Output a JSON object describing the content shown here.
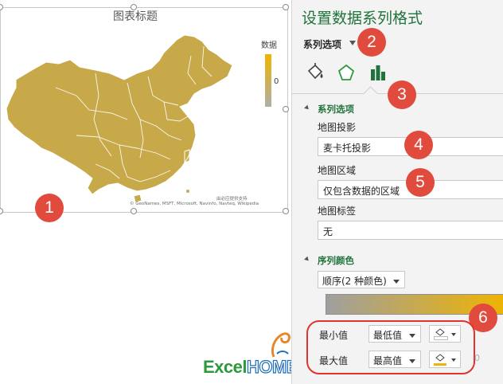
{
  "chart": {
    "title": "图表标题",
    "legend_title": "数据",
    "legend_value": "0",
    "credit_line1": "由必应提供支持",
    "credit_line2": "© GeoNames, MSFT, Microsoft, Navinfo, Navteq, Wikipedia",
    "map_color": "#c8a94a"
  },
  "callouts": [
    "1",
    "2",
    "3",
    "4",
    "5",
    "6"
  ],
  "panel": {
    "title": "设置数据系列格式",
    "options_dropdown_label": "系列选项",
    "tabs": [
      {
        "name": "fill-line",
        "icon": "paint-bucket-icon"
      },
      {
        "name": "effects",
        "icon": "pentagon-icon"
      },
      {
        "name": "series-options",
        "icon": "bar-chart-icon"
      }
    ],
    "section_series": "系列选项",
    "map_projection_label": "地图投影",
    "map_projection_value": "麦卡托投影",
    "map_area_label": "地图区域",
    "map_area_value": "仅包含数据的区域",
    "map_labels_label": "地图标签",
    "map_labels_value": "无",
    "section_color": "序列颜色",
    "color_scheme_value": "顺序(2 种颜色)",
    "min_label": "最小值",
    "min_value": "最低值",
    "max_label": "最大值",
    "max_value": "最高值",
    "faded_number": "0",
    "min_color": "#9f9f9f",
    "max_color": "#f0b400"
  },
  "logo": {
    "excel": "Excel",
    "home": "HOME"
  }
}
